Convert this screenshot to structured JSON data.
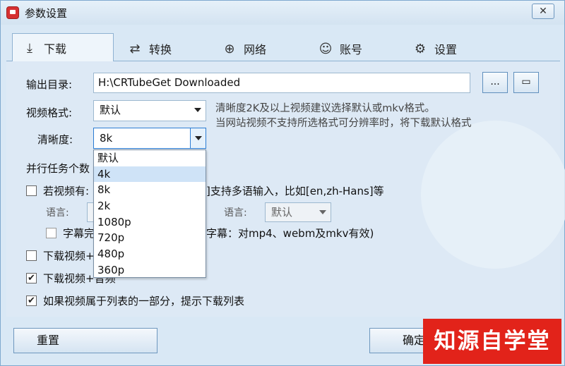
{
  "window": {
    "title": "参数设置",
    "close_label": "✕"
  },
  "tabs": [
    {
      "label": "下载",
      "icon": "download-icon",
      "glyph": "⤓"
    },
    {
      "label": "转换",
      "icon": "convert-icon",
      "glyph": "⇄"
    },
    {
      "label": "网络",
      "icon": "globe-icon",
      "glyph": "⊕"
    },
    {
      "label": "账号",
      "icon": "user-icon",
      "glyph": "☺"
    },
    {
      "label": "设置",
      "icon": "gear-icon",
      "glyph": "⚙"
    }
  ],
  "output": {
    "label": "输出目录:",
    "value": "H:\\CRTubeGet Downloaded",
    "browse_label": "...",
    "open_glyph": "▭"
  },
  "format": {
    "label": "视频格式:",
    "value": "默认",
    "hint_line1": "清晰度2K及以上视频建议选择默认或mkv格式。",
    "hint_line2": "当网站视频不支持所选格式可分辨率时，将下载默认格式"
  },
  "quality": {
    "label": "清晰度:",
    "value": "8k",
    "options": [
      "默认",
      "4k",
      "8k",
      "2k",
      "1080p",
      "720p",
      "480p",
      "360p"
    ],
    "highlighted": "4k"
  },
  "parallel": {
    "label": "并行任务个数"
  },
  "subtitle": {
    "checkbox_label_left": "若视频有:",
    "checkbox_label_right": "]支持多语输入，比如[en,zh-Hans]等",
    "lang_label_left": "语言:",
    "lang_label_right": "语言:",
    "lang_right_value": "默认",
    "embed_label_left": "字幕完",
    "embed_label_right": "字幕：对mp4、webm及mkv有效)"
  },
  "options": {
    "opt1_label": "下载视频+",
    "opt2_label": "下载视频+音频",
    "opt3_label": "如果视频属于列表的一部分，提示下载列表"
  },
  "buttons": {
    "reset": "重置",
    "ok": "确定"
  },
  "logo_text": "知源自学堂",
  "colors": {
    "accent": "#2b7cd3",
    "logo": "#e2231a",
    "background": "#d9e8f5"
  }
}
